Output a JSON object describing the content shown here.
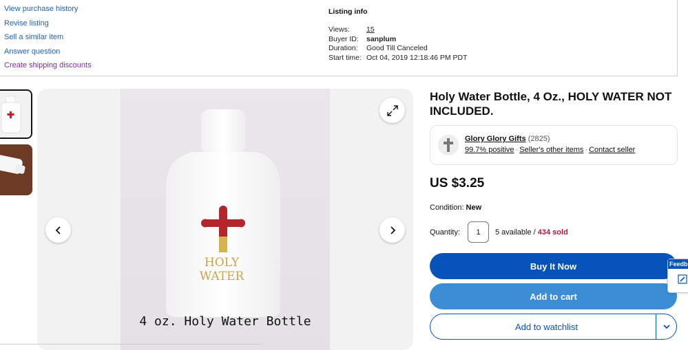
{
  "actions": {
    "links": [
      {
        "label": "View purchase history",
        "color": "#2561b5"
      },
      {
        "label": "Revise listing",
        "color": "#2561b5"
      },
      {
        "label": "Sell a similar item",
        "color": "#2561b5"
      },
      {
        "label": "Answer question",
        "color": "#2561b5"
      },
      {
        "label": "Create shipping discounts",
        "color": "#7a2e9a"
      }
    ]
  },
  "listing_info": {
    "title": "Listing info",
    "rows": [
      {
        "key": "Views:",
        "value": "15"
      },
      {
        "key": "Buyer ID:",
        "value": "sanplum"
      },
      {
        "key": "Duration:",
        "value": "Good Till Canceled"
      },
      {
        "key": "Start time:",
        "value": "Oct 04, 2019 12:18:46 PM PDT"
      }
    ]
  },
  "gallery": {
    "caption": "4 oz. Holy Water Bottle",
    "bottle_text_line1": "HOLY",
    "bottle_text_line2": "WATER"
  },
  "product": {
    "title": "Holy Water Bottle, 4 Oz., HOLY WATER NOT INCLUDED.",
    "price": "US $3.25",
    "condition_label": "Condition:",
    "condition_value": "New",
    "quantity_label": "Quantity:",
    "quantity_value": "1",
    "available": "5 available / ",
    "sold": "434 sold"
  },
  "seller": {
    "name": "Glory Glory Gifts",
    "feedback_count": "(2825)",
    "positive": "99.7% positive",
    "other_items": "Seller's other items",
    "contact": "Contact seller"
  },
  "buttons": {
    "buy_now": "Buy It Now",
    "add_to_cart": "Add to cart",
    "add_to_watchlist": "Add to watchlist"
  },
  "feedback_tab": {
    "label": "Feedb"
  },
  "colors": {
    "primary": "#0654ba",
    "secondary": "#3b8ed6",
    "sold": "#c0143c"
  }
}
